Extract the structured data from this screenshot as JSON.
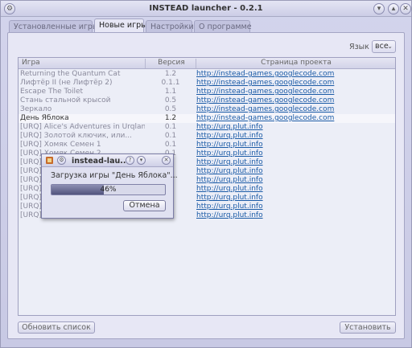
{
  "window": {
    "title": "INSTEAD launcher - 0.2.1"
  },
  "tabs": [
    {
      "label": "Установленные игры",
      "active": false
    },
    {
      "label": "Новые игры",
      "active": true
    },
    {
      "label": "Настройки",
      "active": false
    },
    {
      "label": "О программе",
      "active": false
    }
  ],
  "language": {
    "label": "Язык",
    "value": "все"
  },
  "table": {
    "headers": [
      "Игра",
      "Версия",
      "Страница проекта"
    ],
    "rows": [
      {
        "name": "Returning the Quantum Cat",
        "version": "1.2",
        "url": "http://instead-games.googlecode.com"
      },
      {
        "name": "Лифтёр II (не Лифтёр 2)",
        "version": "0.1.1",
        "url": "http://instead-games.googlecode.com"
      },
      {
        "name": "Escape The Toilet",
        "version": "1.1",
        "url": "http://instead-games.googlecode.com"
      },
      {
        "name": "Стань стальной крысой",
        "version": "0.5",
        "url": "http://instead-games.googlecode.com"
      },
      {
        "name": "Зеркало",
        "version": "0.5",
        "url": "http://instead-games.googlecode.com"
      },
      {
        "name": "День Яблока",
        "version": "1.2",
        "url": "http://instead-games.googlecode.com",
        "selected": true
      },
      {
        "name": "[URQ] Alice's Adventures in Urqland",
        "version": "0.1",
        "url": "http://urq.plut.info"
      },
      {
        "name": "[URQ] Золотой ключик, или...",
        "version": "0.1",
        "url": "http://urq.plut.info"
      },
      {
        "name": "[URQ] Хомяк Семен 1",
        "version": "0.1",
        "url": "http://urq.plut.info"
      },
      {
        "name": "[URQ] Хомяк Семен 2",
        "version": "0.1",
        "url": "http://urq.plut.info"
      },
      {
        "name": "[URQ]",
        "version": "",
        "url": "http://urq.plut.info"
      },
      {
        "name": "[URQ]",
        "version": "",
        "url": "http://urq.plut.info"
      },
      {
        "name": "[URQ]",
        "version": "",
        "url": "http://urq.plut.info"
      },
      {
        "name": "[URQ]",
        "version": "",
        "url": "http://urq.plut.info"
      },
      {
        "name": "[URQ]",
        "version": "",
        "url": "http://urq.plut.info"
      },
      {
        "name": "[URQ]",
        "version": "",
        "url": "http://urq.plut.info"
      },
      {
        "name": "[URQ]",
        "version": "",
        "url": "http://urq.plut.info"
      }
    ]
  },
  "buttons": {
    "refresh": "Обновить список",
    "install": "Установить"
  },
  "dialog": {
    "title": "instead-lau...",
    "message": "Загрузка игры \"День Яблока\"...",
    "progress_percent": 46,
    "progress_text": "46%",
    "cancel": "Отмена"
  }
}
